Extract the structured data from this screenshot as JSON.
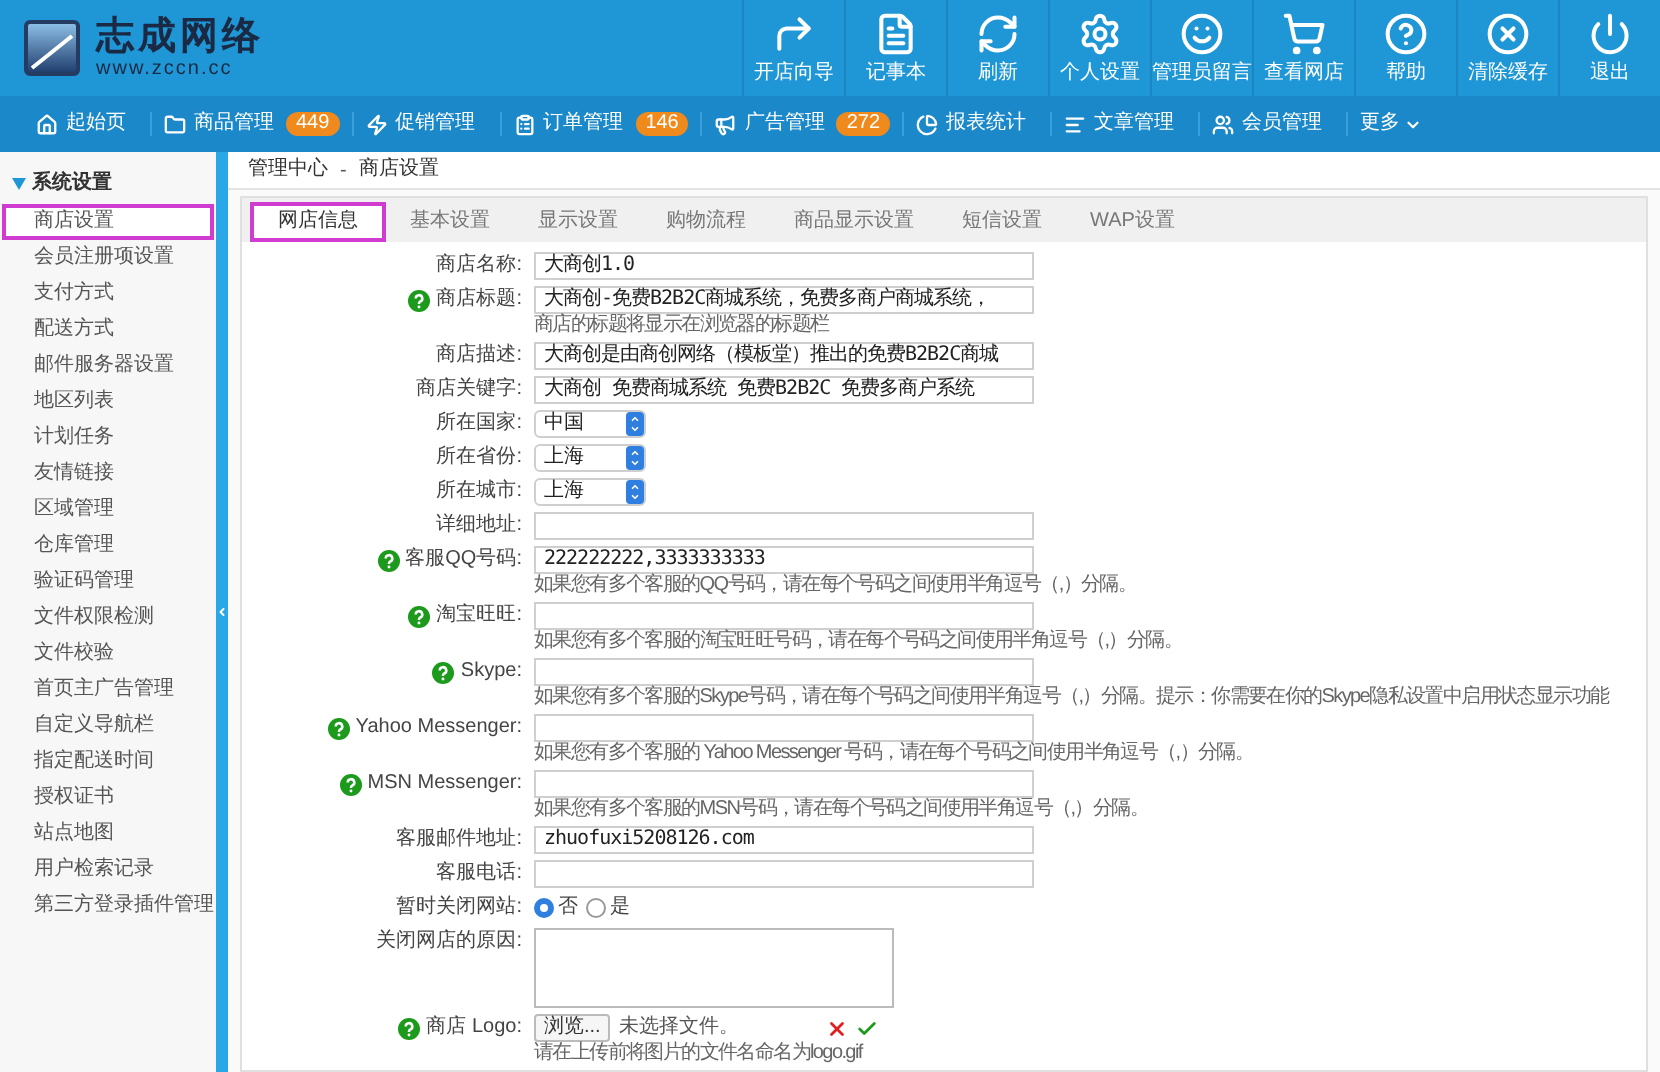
{
  "header": {
    "logo": {
      "title": "志成网络",
      "url": "www.zccn.cc"
    },
    "tools": [
      {
        "label": "开店向导"
      },
      {
        "label": "记事本"
      },
      {
        "label": "刷新"
      },
      {
        "label": "个人设置"
      },
      {
        "label": "管理员留言"
      },
      {
        "label": "查看网店"
      },
      {
        "label": "帮助"
      },
      {
        "label": "清除缓存"
      },
      {
        "label": "退出"
      }
    ]
  },
  "nav": {
    "items": [
      {
        "label": "起始页"
      },
      {
        "label": "商品管理",
        "badge": "449"
      },
      {
        "label": "促销管理"
      },
      {
        "label": "订单管理",
        "badge": "146"
      },
      {
        "label": "广告管理",
        "badge": "272"
      },
      {
        "label": "报表统计"
      },
      {
        "label": "文章管理"
      },
      {
        "label": "会员管理"
      }
    ],
    "more": "更多"
  },
  "sidebar": {
    "title": "系统设置",
    "expanded": true,
    "items": [
      {
        "label": "商店设置",
        "selected": true
      },
      {
        "label": "会员注册项设置",
        "selected": false
      },
      {
        "label": "支付方式",
        "selected": false
      },
      {
        "label": "配送方式",
        "selected": false
      },
      {
        "label": "邮件服务器设置",
        "selected": false
      },
      {
        "label": "地区列表",
        "selected": false
      },
      {
        "label": "计划任务",
        "selected": false
      },
      {
        "label": "友情链接",
        "selected": false
      },
      {
        "label": "区域管理",
        "selected": false
      },
      {
        "label": "仓库管理",
        "selected": false
      },
      {
        "label": "验证码管理",
        "selected": false
      },
      {
        "label": "文件权限检测",
        "selected": false
      },
      {
        "label": "文件校验",
        "selected": false
      },
      {
        "label": "首页主广告管理",
        "selected": false
      },
      {
        "label": "自定义导航栏",
        "selected": false
      },
      {
        "label": "指定配送时间",
        "selected": false
      },
      {
        "label": "授权证书",
        "selected": false
      },
      {
        "label": "站点地图",
        "selected": false
      },
      {
        "label": "用户检索记录",
        "selected": false
      },
      {
        "label": "第三方登录插件管理",
        "selected": false
      }
    ]
  },
  "breadcrumb": {
    "items": [
      "管理中心",
      "商店设置"
    ],
    "separator": "-"
  },
  "tabs": [
    {
      "label": "网店信息",
      "selected": true
    },
    {
      "label": "基本设置",
      "selected": false
    },
    {
      "label": "显示设置",
      "selected": false
    },
    {
      "label": "购物流程",
      "selected": false
    },
    {
      "label": "商品显示设置",
      "selected": false
    },
    {
      "label": "短信设置",
      "selected": false
    },
    {
      "label": "WAP设置",
      "selected": false
    }
  ],
  "fields": [
    {
      "kind": "text",
      "label": "商店名称:",
      "help": false,
      "value": "大商创1.0"
    },
    {
      "kind": "text",
      "label": "商店标题:",
      "help": true,
      "value": "大商创-免费B2B2C商城系统，免费多商户商城系统，",
      "hint": "商店的标题将显示在浏览器的标题栏"
    },
    {
      "kind": "text",
      "label": "商店描述:",
      "help": false,
      "value": "大商创是由商创网络（模板堂）推出的免费B2B2C商城"
    },
    {
      "kind": "text",
      "label": "商店关键字:",
      "help": false,
      "value": "大商创 免费商城系统 免费B2B2C 免费多商户系统"
    },
    {
      "kind": "select",
      "label": "所在国家:",
      "help": false,
      "value": "中国"
    },
    {
      "kind": "select",
      "label": "所在省份:",
      "help": false,
      "value": "上海"
    },
    {
      "kind": "select",
      "label": "所在城市:",
      "help": false,
      "value": "上海"
    },
    {
      "kind": "text",
      "label": "详细地址:",
      "help": false
    },
    {
      "kind": "text",
      "label": "客服QQ号码:",
      "help": true,
      "value": "222222222,3333333333",
      "hint": "如果您有多个客服的QQ号码，请在每个号码之间使用半角逗号（,）分隔。"
    },
    {
      "kind": "text",
      "label": "淘宝旺旺:",
      "help": true,
      "hint": "如果您有多个客服的淘宝旺旺号码，请在每个号码之间使用半角逗号（,）分隔。"
    },
    {
      "kind": "text",
      "label": "Skype:",
      "help": true,
      "hint": "如果您有多个客服的Skype号码，请在每个号码之间使用半角逗号（,）分隔。提示：你需要在你的Skype隐私设置中启用状态显示功能"
    },
    {
      "kind": "text",
      "label": "Yahoo Messenger:",
      "help": true,
      "hint": "如果您有多个客服的 Yahoo Messenger 号码，请在每个号码之间使用半角逗号（,）分隔。"
    },
    {
      "kind": "text",
      "label": "MSN Messenger:",
      "help": true,
      "hint": "如果您有多个客服的MSN号码，请在每个号码之间使用半角逗号（,）分隔。"
    },
    {
      "kind": "text",
      "label": "客服邮件地址:",
      "help": false,
      "value": "zhuofuxi5208126.com"
    },
    {
      "kind": "text",
      "label": "客服电话:",
      "help": false
    },
    {
      "kind": "radio",
      "label": "暂时关闭网站:",
      "help": false,
      "options": [
        {
          "label": "否",
          "selected": true
        },
        {
          "label": "是",
          "selected": false
        }
      ]
    },
    {
      "kind": "textarea",
      "label": "关闭网店的原因:",
      "help": false
    },
    {
      "kind": "file",
      "label": "商店 Logo:",
      "help": true,
      "button": "浏览...",
      "status": "未选择文件。",
      "hint": "请在上传前将图片的文件名命名为logo.gif"
    }
  ]
}
